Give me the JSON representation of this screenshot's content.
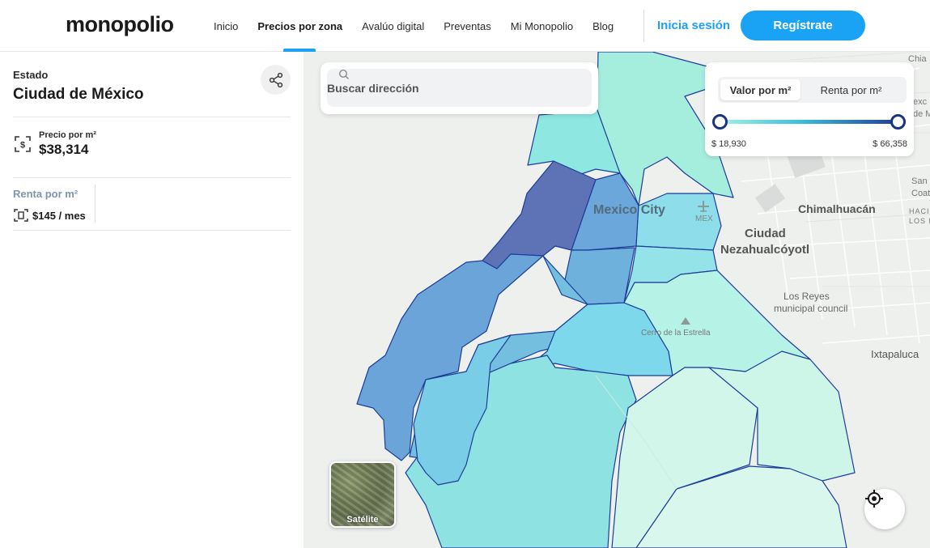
{
  "header": {
    "logo": "monopolio",
    "nav": [
      {
        "label": "Inicio",
        "active": false
      },
      {
        "label": "Precios por zona",
        "active": true
      },
      {
        "label": "Avalúo digital",
        "active": false
      },
      {
        "label": "Preventas",
        "active": false
      },
      {
        "label": "Mi Monopolio",
        "active": false
      },
      {
        "label": "Blog",
        "active": false
      }
    ],
    "login_label": "Inicia sesión",
    "register_label": "Regístrate"
  },
  "sidebar": {
    "state_label": "Estado",
    "state_name": "Ciudad de México",
    "price": {
      "label": "Precio por m²",
      "value": "$38,314"
    },
    "rent": {
      "label": "Renta por m²",
      "value": "$145 / mes"
    }
  },
  "map": {
    "search": {
      "placeholder": "Buscar dirección"
    },
    "filter": {
      "options": [
        "Valor por m²",
        "Renta por m²"
      ],
      "selected": "Valor por m²",
      "range_min": "$ 18,930",
      "range_max": "$ 66,358"
    },
    "satellite_label": "Satélite",
    "labels": {
      "mexico_city": "Mexico City",
      "mex": "MEX",
      "chimalhuacan": "Chimalhuacán",
      "neza_1": "Ciudad",
      "neza_2": "Nezahualcóyotl",
      "reyes_1": "Los Reyes",
      "reyes_2": "municipal council",
      "estrella": "Cerro de la Estrella",
      "ixtapaluca": "Ixtapaluca",
      "chia": "Chia",
      "exc": "exc",
      "dem": "de M",
      "san": "San",
      "coat": "Coat",
      "hacien": "HACIEN",
      "los_re": "LOS RE"
    },
    "colors": {
      "darkest": "#5e72b6",
      "dark": "#6aa9db",
      "mid": "#72bedf",
      "light": "#7dd8ea",
      "lighter": "#8ee5e2",
      "mint": "#b9f2e4",
      "palest": "#d8f6ea",
      "outline": "#1c3d9a"
    }
  }
}
